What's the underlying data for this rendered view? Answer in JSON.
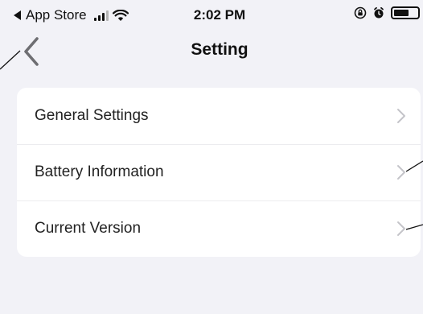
{
  "status_bar": {
    "back_app": "App Store",
    "time": "2:02 PM"
  },
  "nav": {
    "title": "Setting"
  },
  "settings": {
    "items": [
      {
        "label": "General Settings"
      },
      {
        "label": "Battery Information"
      },
      {
        "label": "Current Version"
      }
    ]
  },
  "icons": {
    "back": "chevron-left-icon",
    "row": "chevron-right-icon",
    "status": [
      "signal-icon",
      "wifi-icon",
      "orientation-lock-icon",
      "alarm-icon",
      "battery-icon"
    ]
  },
  "colors": {
    "background": "#f2f2f7",
    "card": "#ffffff",
    "chevron": "#c4c4c9"
  }
}
